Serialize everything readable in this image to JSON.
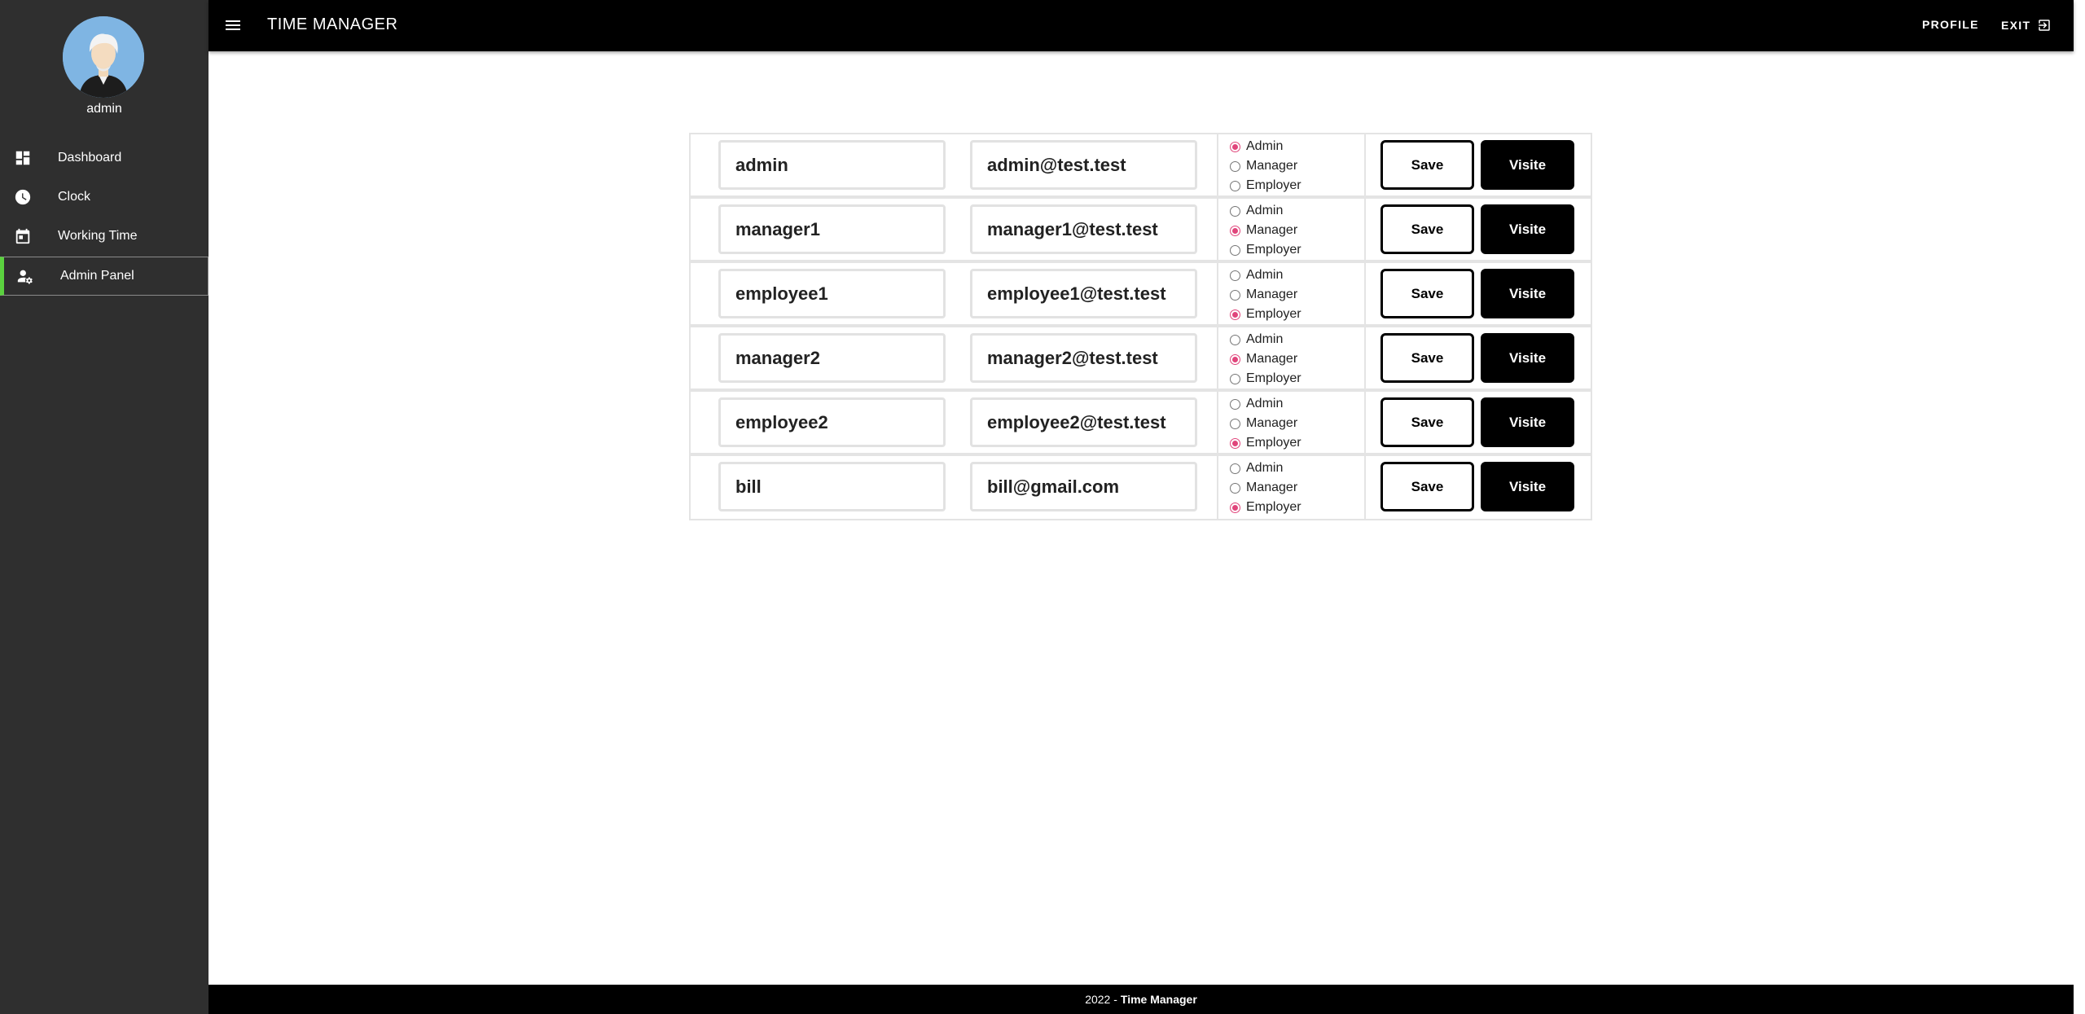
{
  "app": {
    "title": "TIME MANAGER"
  },
  "header": {
    "profile_label": "PROFILE",
    "exit_label": "EXIT"
  },
  "sidebar": {
    "username": "admin",
    "items": [
      {
        "label": "Dashboard",
        "icon": "dashboard-icon"
      },
      {
        "label": "Clock",
        "icon": "clock-icon"
      },
      {
        "label": "Working Time",
        "icon": "calendar-icon"
      },
      {
        "label": "Admin Panel",
        "icon": "admin-panel-icon",
        "active": true
      }
    ]
  },
  "role_options": [
    "Admin",
    "Manager",
    "Employer"
  ],
  "users": [
    {
      "name": "admin",
      "email": "admin@test.test",
      "role": "Admin"
    },
    {
      "name": "manager1",
      "email": "manager1@test.test",
      "role": "Manager"
    },
    {
      "name": "employee1",
      "email": "employee1@test.test",
      "role": "Employer"
    },
    {
      "name": "manager2",
      "email": "manager2@test.test",
      "role": "Manager"
    },
    {
      "name": "employee2",
      "email": "employee2@test.test",
      "role": "Employer"
    },
    {
      "name": "bill",
      "email": "bill@gmail.com",
      "role": "Employer"
    }
  ],
  "row_actions": {
    "save_label": "Save",
    "visit_label": "Visite"
  },
  "footer": {
    "year": "2022 -",
    "brand": "Time Manager"
  },
  "colors": {
    "active_indicator": "#5bd13f",
    "radio_checked": "#e0457b",
    "sidebar_bg": "#2f2f2f",
    "topbar_bg": "#000000"
  }
}
